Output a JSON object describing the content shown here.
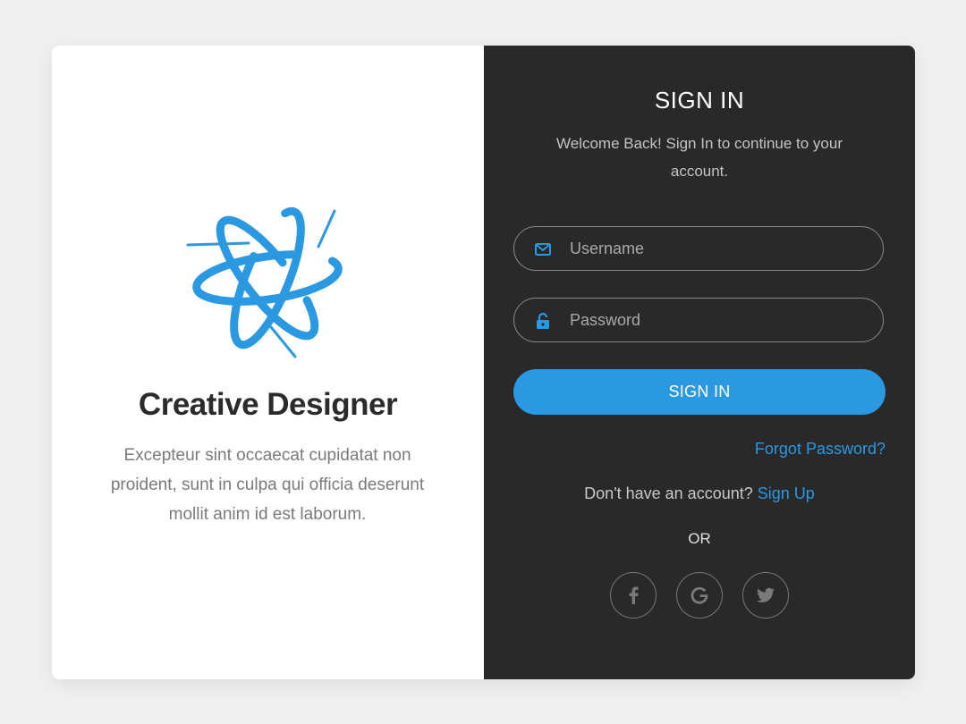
{
  "brand": {
    "title": "Creative Designer",
    "description": "Excepteur sint occaecat cupidatat non proident, sunt in culpa qui officia deserunt mollit anim id est laborum.",
    "logo_icon": "swirl-star-logo-icon",
    "accent_color": "#2b98e2"
  },
  "signin": {
    "title": "SIGN IN",
    "welcome": "Welcome Back! Sign In to continue to your account.",
    "username": {
      "placeholder": "Username",
      "value": "",
      "icon": "envelope-icon"
    },
    "password": {
      "placeholder": "Password",
      "value": "",
      "icon": "unlock-icon"
    },
    "button_label": "SIGN IN",
    "forgot_label": "Forgot Password?",
    "no_account_text": "Don't have an account?",
    "signup_label": "Sign Up",
    "or_label": "OR",
    "social": [
      {
        "name": "facebook",
        "icon": "facebook-icon"
      },
      {
        "name": "google",
        "icon": "google-icon"
      },
      {
        "name": "twitter",
        "icon": "twitter-icon"
      }
    ]
  },
  "colors": {
    "page_bg": "#f0f0f0",
    "left_panel_bg": "#ffffff",
    "right_panel_bg": "#292929",
    "title_text": "#2b2b2b",
    "muted_text": "#7a7a7a"
  }
}
